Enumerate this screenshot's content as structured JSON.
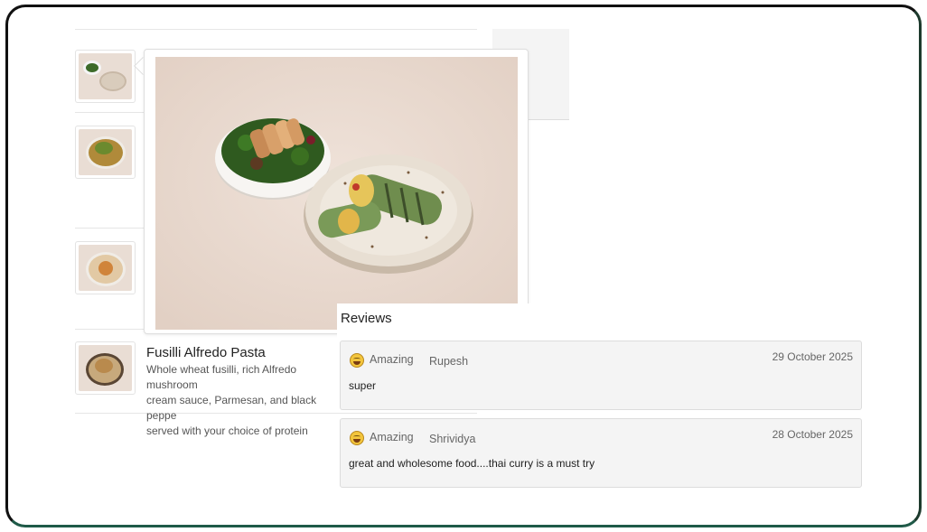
{
  "menu": {
    "items": [
      {
        "name": "",
        "description": ""
      },
      {
        "name": "",
        "description": ""
      },
      {
        "name": "",
        "description": ""
      },
      {
        "name": "Fusilli Alfredo Pasta",
        "description_lines": [
          "Whole wheat fusilli, rich Alfredo mushroom",
          "cream sauce, Parmesan, and black peppe",
          "served with your choice of protein"
        ]
      }
    ]
  },
  "popover": {
    "image_icon": "food-photo-salad-bowl-and-wrap"
  },
  "reviews": {
    "title": "Reviews",
    "list": [
      {
        "rating": "Amazing",
        "reviewer": "Rupesh",
        "date": "29 October 2025",
        "text": "super",
        "icon": "grinning-emoji-icon"
      },
      {
        "rating": "Amazing",
        "reviewer": "Shrividya",
        "date": "28 October 2025",
        "text": "great and wholesome food....thai curry is a must try",
        "icon": "grinning-emoji-icon"
      }
    ]
  },
  "colors": {
    "card_bg": "#f4f4f4",
    "border": "#dcdcdc",
    "frame_border": "#1f5a48"
  }
}
